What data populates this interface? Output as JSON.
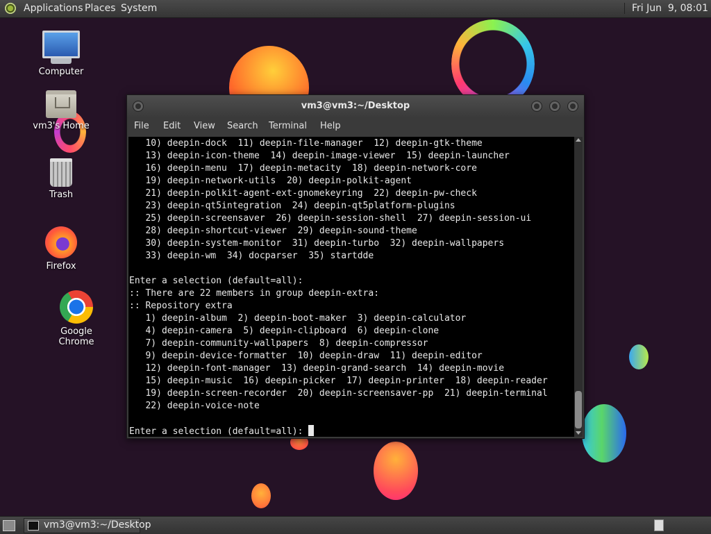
{
  "top_panel": {
    "menus": [
      "Applications",
      "Places",
      "System"
    ],
    "clock": "Fri Jun  9, 08:01"
  },
  "desktop_icons": [
    {
      "label": "Computer",
      "icon": "computer-icon"
    },
    {
      "label": "vm3's Home",
      "icon": "home-folder-icon"
    },
    {
      "label": "Trash",
      "icon": "trash-icon"
    },
    {
      "label": "Firefox",
      "icon": "firefox-icon"
    },
    {
      "label": "Google Chrome",
      "icon": "chrome-icon"
    }
  ],
  "terminal": {
    "title": "vm3@vm3:~/Desktop",
    "menus": [
      "File",
      "Edit",
      "View",
      "Search",
      "Terminal",
      "Help"
    ],
    "lines": [
      "   10) deepin-dock  11) deepin-file-manager  12) deepin-gtk-theme",
      "   13) deepin-icon-theme  14) deepin-image-viewer  15) deepin-launcher",
      "   16) deepin-menu  17) deepin-metacity  18) deepin-network-core",
      "   19) deepin-network-utils  20) deepin-polkit-agent",
      "   21) deepin-polkit-agent-ext-gnomekeyring  22) deepin-pw-check",
      "   23) deepin-qt5integration  24) deepin-qt5platform-plugins",
      "   25) deepin-screensaver  26) deepin-session-shell  27) deepin-session-ui",
      "   28) deepin-shortcut-viewer  29) deepin-sound-theme",
      "   30) deepin-system-monitor  31) deepin-turbo  32) deepin-wallpapers",
      "   33) deepin-wm  34) docparser  35) startdde",
      "",
      "Enter a selection (default=all):",
      ":: There are 22 members in group deepin-extra:",
      ":: Repository extra",
      "   1) deepin-album  2) deepin-boot-maker  3) deepin-calculator",
      "   4) deepin-camera  5) deepin-clipboard  6) deepin-clone",
      "   7) deepin-community-wallpapers  8) deepin-compressor",
      "   9) deepin-device-formatter  10) deepin-draw  11) deepin-editor",
      "   12) deepin-font-manager  13) deepin-grand-search  14) deepin-movie",
      "   15) deepin-music  16) deepin-picker  17) deepin-printer  18) deepin-reader",
      "   19) deepin-screen-recorder  20) deepin-screensaver-pp  21) deepin-terminal",
      "   22) deepin-voice-note",
      ""
    ],
    "prompt": "Enter a selection (default=all): "
  },
  "taskbar": {
    "window_label": "vm3@vm3:~/Desktop"
  }
}
